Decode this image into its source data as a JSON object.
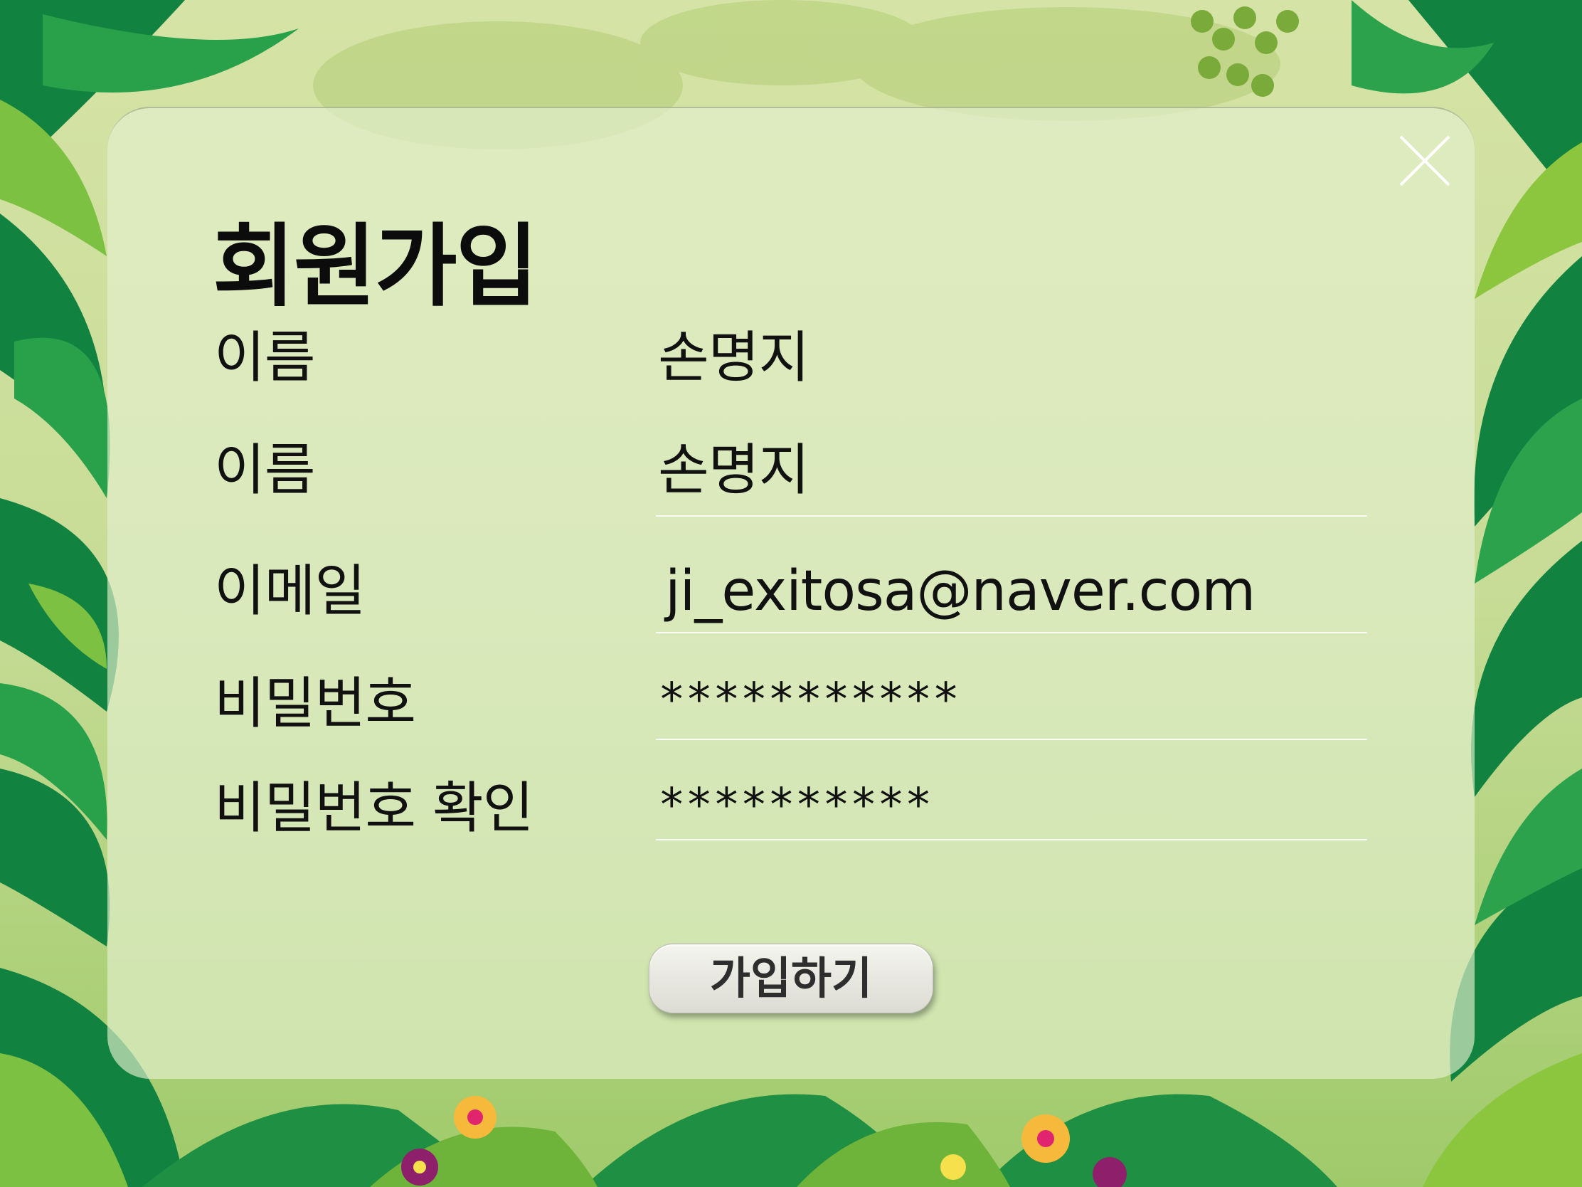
{
  "dialog": {
    "title": "회원가입",
    "close_icon": "close-icon"
  },
  "form": {
    "fields": [
      {
        "label": "이름",
        "value": "손명지"
      },
      {
        "label": "이름",
        "value": "손명지"
      },
      {
        "label": "이메일",
        "value": "ji_exitosa@naver.com"
      },
      {
        "label": "비밀번호",
        "value": "***********"
      },
      {
        "label": "비밀번호 확인",
        "value": "**********"
      }
    ],
    "submit_label": "가입하기"
  },
  "colors": {
    "panel": "#e4f0ce",
    "text": "#111111",
    "button": "#ececE6",
    "background_leaf_dark": "#0f7a3a",
    "background_leaf_light": "#8cc63f"
  }
}
